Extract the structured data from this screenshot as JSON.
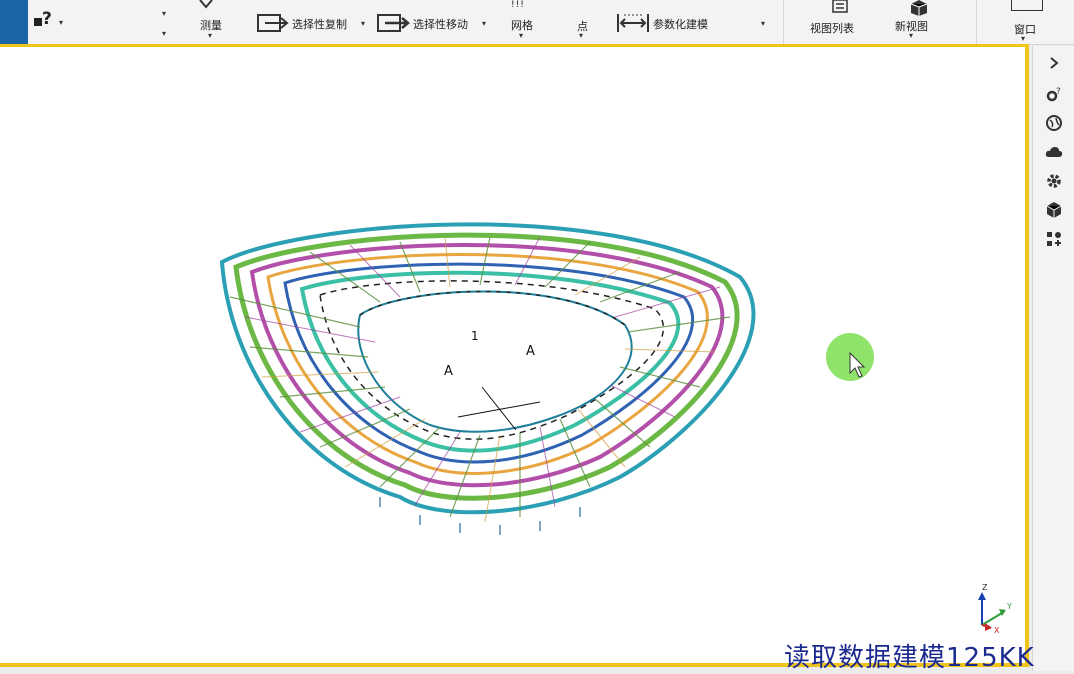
{
  "ribbon": {
    "help_label": "?",
    "measure_label": "测量",
    "selective_copy_label": "选择性复制",
    "selective_move_label": "选择性移动",
    "grid_label": "网格",
    "point_label": "点",
    "parametric_label": "参数化建模",
    "view_list_label": "视图列表",
    "new_view_label": "新视图",
    "window_label": "窗口"
  },
  "model": {
    "annotation_1": "1",
    "annotation_a_left": "A",
    "annotation_a_right": "A"
  },
  "axis": {
    "z": "Z",
    "y": "Y",
    "x": "X"
  },
  "watermark": "读取数据建模125KK",
  "colors": {
    "accent": "#f0c419",
    "tab_blue": "#1a65a6",
    "cursor_highlight": "#8fe36a"
  }
}
